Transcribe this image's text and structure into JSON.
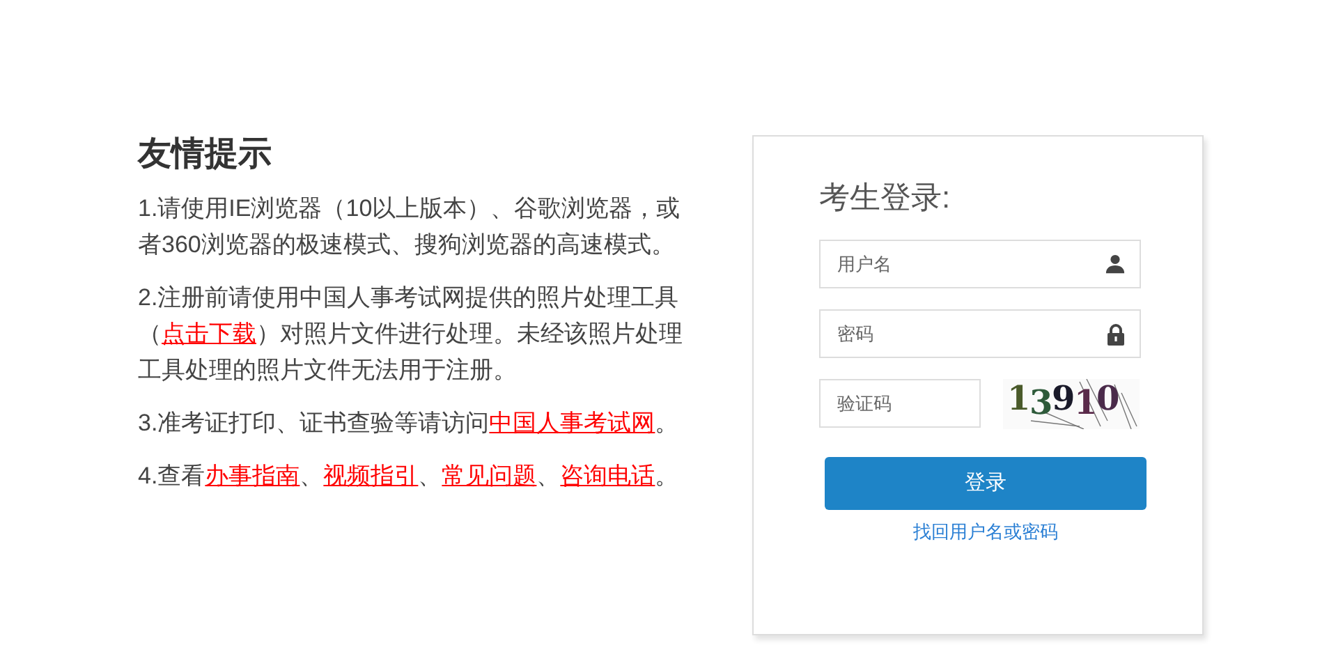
{
  "tips": {
    "title": "友情提示",
    "paragraphs": [
      [
        {
          "text": "1.请使用IE浏览器（10以上版本）、谷歌浏览器，或者360浏览器的极速模式、搜狗浏览器的高速模式。",
          "link": false
        }
      ],
      [
        {
          "text": "2.注册前请使用中国人事考试网提供的照片处理工具（",
          "link": false
        },
        {
          "text": "点击下载",
          "link": true
        },
        {
          "text": "）对照片文件进行处理。未经该照片处理工具处理的照片文件无法用于注册。",
          "link": false
        }
      ],
      [
        {
          "text": "3.准考证打印、证书查验等请访问",
          "link": false
        },
        {
          "text": "中国人事考试网",
          "link": true
        },
        {
          "text": "。",
          "link": false
        }
      ],
      [
        {
          "text": "4.查看",
          "link": false
        },
        {
          "text": "办事指南",
          "link": true
        },
        {
          "text": "、",
          "link": false
        },
        {
          "text": "视频指引",
          "link": true
        },
        {
          "text": "、",
          "link": false
        },
        {
          "text": "常见问题",
          "link": true
        },
        {
          "text": "、",
          "link": false
        },
        {
          "text": "咨询电话",
          "link": true
        },
        {
          "text": "。",
          "link": false
        }
      ]
    ]
  },
  "login": {
    "title": "考生登录:",
    "username": {
      "placeholder": "用户名"
    },
    "password": {
      "placeholder": "密码"
    },
    "captcha": {
      "placeholder": "验证码",
      "code": "13910"
    },
    "submit": "登录",
    "recover_link": "找回用户名或密码"
  }
}
